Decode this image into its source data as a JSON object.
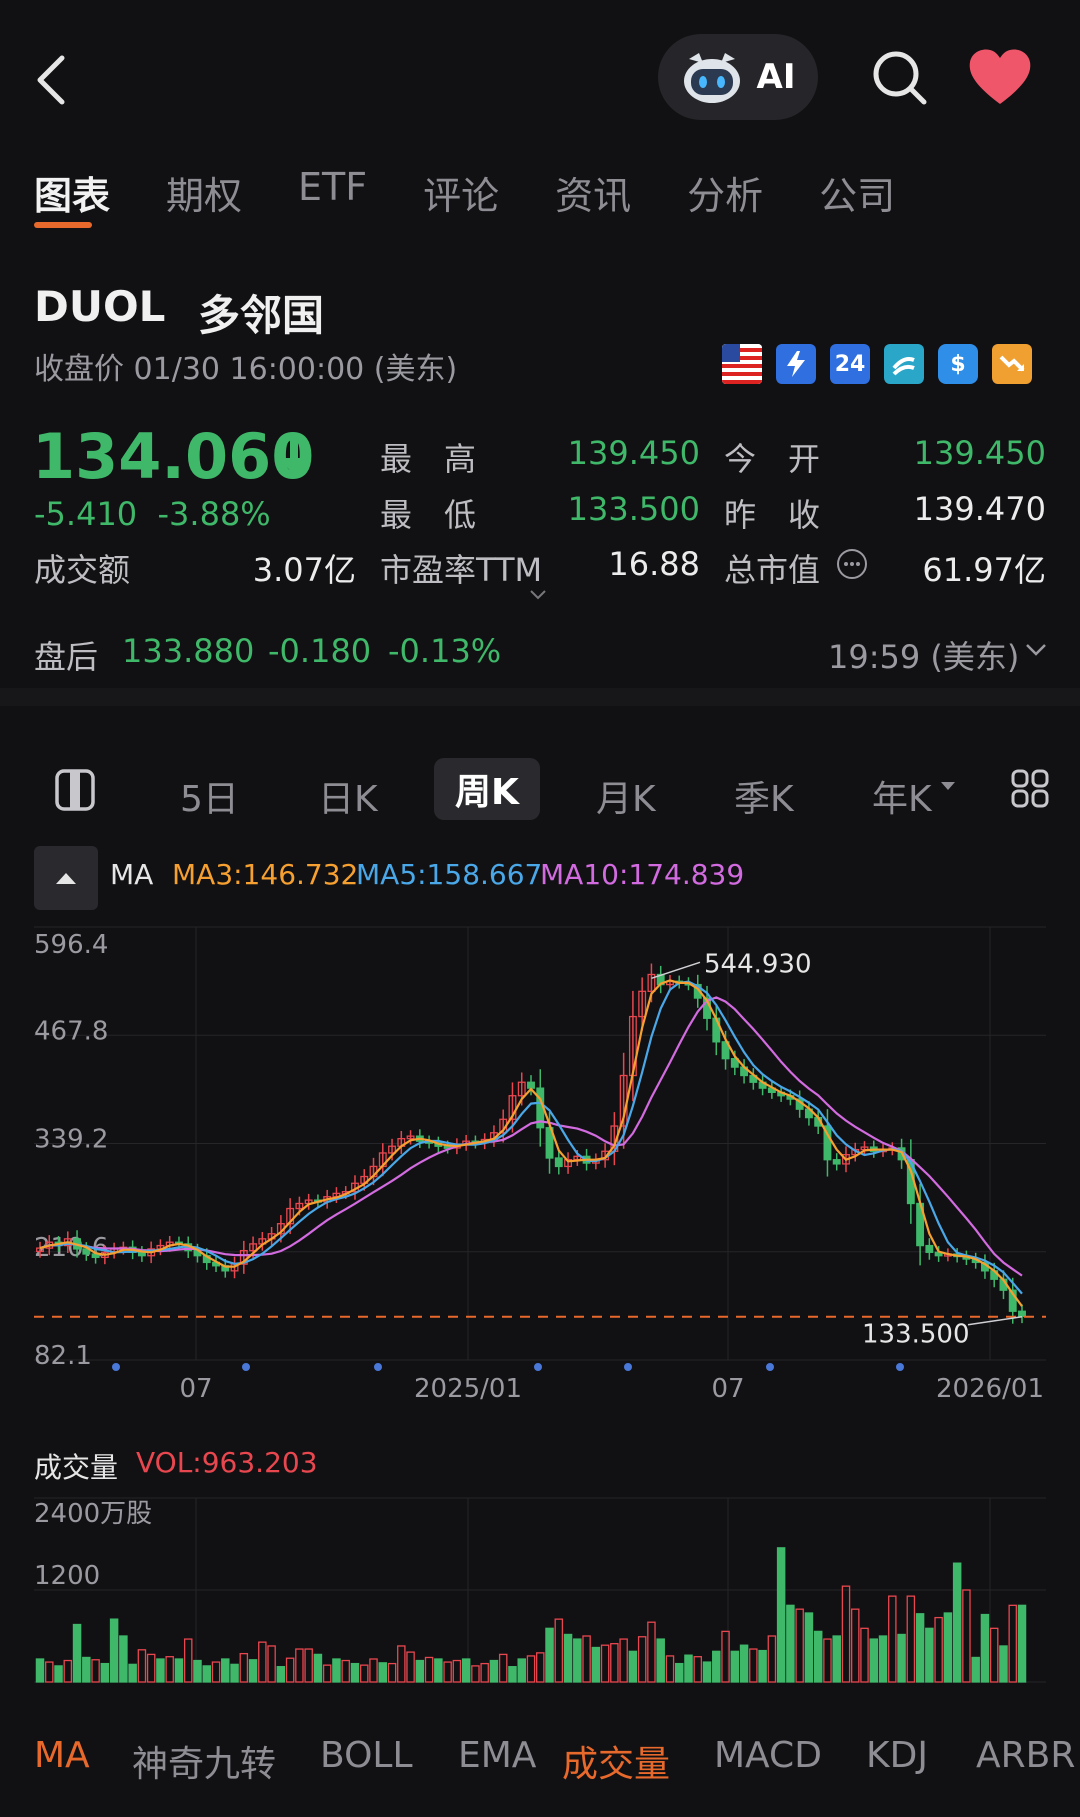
{
  "header": {
    "ai_label": "AI",
    "tabs": [
      "图表",
      "期权",
      "ETF",
      "评论",
      "资讯",
      "分析",
      "公司"
    ]
  },
  "stock": {
    "symbol": "DUOL",
    "name": "多邻国",
    "close_label": "收盘价 01/30 16:00:00 (美东)",
    "price": "134.060",
    "change": "-5.410",
    "change_pct": "-3.88%",
    "badges": [
      "24",
      "$"
    ],
    "quotes": {
      "high_label": "最　高",
      "high": "139.450",
      "open_label": "今　开",
      "open": "139.450",
      "low_label": "最　低",
      "low": "133.500",
      "prev_label": "昨　收",
      "prev": "139.470",
      "turnover_label": "成交额",
      "turnover": "3.07亿",
      "pe_label": "市盈率TTM",
      "pe": "16.88",
      "mcap_label": "总市值",
      "mcap": "61.97亿"
    },
    "after_hours": {
      "label": "盘后",
      "price": "133.880",
      "change": "-0.180",
      "pct": "-0.13%",
      "time": "19:59 (美东)"
    }
  },
  "periods": [
    "5日",
    "日K",
    "周K",
    "月K",
    "季K",
    "年K"
  ],
  "ma_legend": {
    "ma": "MA",
    "ma3": "MA3:146.732",
    "ma5": "MA5:158.667",
    "ma10": "MA10:174.839"
  },
  "colors": {
    "up": "#e8474f",
    "down": "#3fb86a",
    "ma3": "#f5a030",
    "ma5": "#4aa8e8",
    "ma10": "#d36be0",
    "accent": "#e8692c"
  },
  "chart_data": [
    {
      "type": "candlestick",
      "title": "",
      "y_ticks": [
        "596.4",
        "467.8",
        "339.2",
        "210.6",
        "82.1"
      ],
      "x_ticks": [
        "07",
        "2025/01",
        "07",
        "2026/01"
      ],
      "annotations": {
        "high": "544.930",
        "low": "133.500"
      },
      "close_series": [
        215,
        222,
        218,
        226,
        214,
        208,
        204,
        210,
        214,
        216,
        210,
        206,
        214,
        218,
        222,
        220,
        212,
        206,
        198,
        194,
        188,
        196,
        212,
        220,
        226,
        232,
        244,
        262,
        268,
        272,
        270,
        276,
        280,
        282,
        292,
        300,
        312,
        328,
        336,
        345,
        348,
        342,
        340,
        336,
        334,
        338,
        342,
        340,
        344,
        352,
        368,
        396,
        412,
        405,
        358,
        322,
        312,
        320,
        324,
        316,
        320,
        330,
        360,
        420,
        490,
        520,
        540,
        528,
        532,
        530,
        528,
        512,
        488,
        460,
        440,
        430,
        420,
        412,
        405,
        400,
        396,
        392,
        380,
        370,
        360,
        320,
        315,
        326,
        332,
        335,
        330,
        332,
        334,
        320,
        268,
        218,
        210,
        206,
        208,
        205,
        202,
        198,
        188,
        178,
        165,
        140,
        134
      ],
      "ma3": [
        215,
        218,
        220,
        222,
        219,
        216,
        209,
        207,
        209,
        213,
        213,
        211,
        210,
        213,
        218,
        220,
        218,
        213,
        205,
        199,
        193,
        193,
        199,
        209,
        219,
        226,
        234,
        246,
        258,
        267,
        270,
        273,
        275,
        279,
        285,
        291,
        301,
        313,
        325,
        336,
        343,
        345,
        343,
        339,
        337,
        336,
        338,
        340,
        342,
        345,
        355,
        372,
        392,
        404,
        392,
        362,
        331,
        318,
        319,
        320,
        320,
        322,
        337,
        370,
        423,
        477,
        517,
        529,
        533,
        530,
        530,
        523,
        509,
        487,
        463,
        443,
        430,
        421,
        412,
        406,
        400,
        396,
        389,
        381,
        370,
        350,
        332,
        320,
        324,
        331,
        332,
        332,
        332,
        329,
        307,
        269,
        232,
        211,
        208,
        206,
        205,
        202,
        196,
        188,
        177,
        161,
        146
      ]
    },
    {
      "type": "bar",
      "title": "成交量",
      "series_label": "VOL:963.203",
      "y_ticks": [
        "2400万股",
        "1200"
      ],
      "values": [
        300,
        260,
        210,
        280,
        750,
        320,
        290,
        240,
        820,
        600,
        230,
        420,
        360,
        300,
        330,
        300,
        560,
        280,
        210,
        260,
        300,
        230,
        370,
        290,
        520,
        470,
        200,
        310,
        430,
        430,
        360,
        220,
        300,
        280,
        240,
        220,
        300,
        250,
        240,
        470,
        390,
        280,
        320,
        300,
        260,
        280,
        300,
        210,
        240,
        280,
        360,
        200,
        300,
        340,
        380,
        700,
        820,
        620,
        560,
        600,
        450,
        480,
        500,
        560,
        400,
        590,
        780,
        560,
        340,
        240,
        350,
        330,
        260,
        400,
        660,
        400,
        480,
        430,
        410,
        600,
        1750,
        1000,
        950,
        900,
        660,
        560,
        600,
        1250,
        950,
        700,
        560,
        600,
        1120,
        620,
        1120,
        890,
        700,
        840,
        900,
        1550,
        1200,
        320,
        880,
        700,
        470,
        1000,
        1000
      ],
      "up": [
        0,
        1,
        0,
        1,
        0,
        0,
        1,
        0,
        0,
        0,
        0,
        1,
        1,
        0,
        1,
        0,
        1,
        0,
        0,
        1,
        0,
        0,
        1,
        0,
        1,
        1,
        0,
        1,
        1,
        1,
        0,
        1,
        0,
        1,
        0,
        1,
        1,
        0,
        1,
        1,
        1,
        0,
        1,
        0,
        1,
        1,
        0,
        1,
        1,
        0,
        1,
        0,
        0,
        1,
        1,
        0,
        1,
        0,
        0,
        1,
        0,
        1,
        1,
        1,
        0,
        1,
        1,
        0,
        1,
        0,
        0,
        1,
        0,
        0,
        1,
        0,
        0,
        1,
        0,
        1,
        0,
        0,
        1,
        0,
        0,
        1,
        0,
        1,
        1,
        1,
        0,
        0,
        1,
        0,
        1,
        0,
        0,
        1,
        0,
        0,
        1,
        0,
        0,
        1,
        0,
        1,
        0
      ]
    }
  ],
  "indicators": [
    "MA",
    "神奇九转",
    "BOLL",
    "EMA",
    "成交量",
    "MACD",
    "KDJ",
    "ARBR"
  ]
}
